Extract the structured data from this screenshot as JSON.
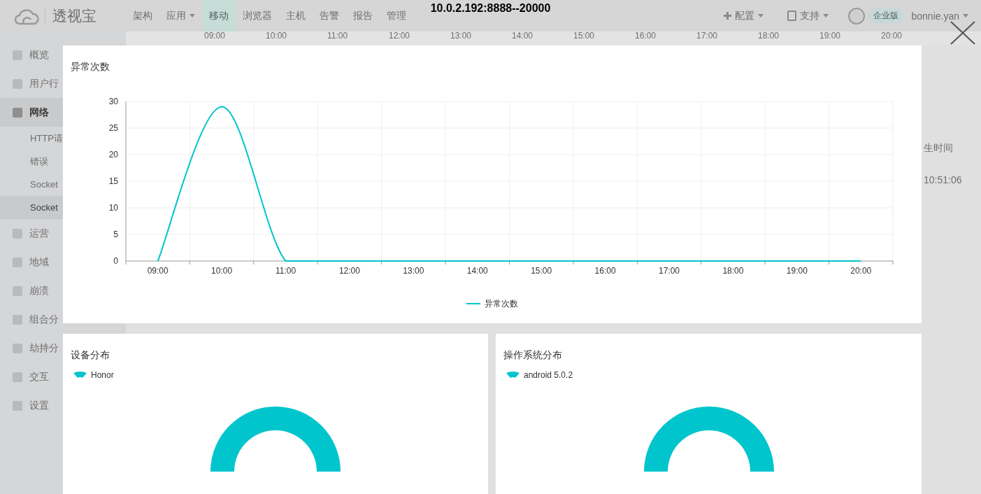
{
  "header": {
    "logo": "透视宝",
    "nav": [
      {
        "label": "架构",
        "selected": false,
        "has_menu": false
      },
      {
        "label": "应用",
        "selected": false,
        "has_menu": true
      },
      {
        "label": "移动",
        "selected": true,
        "has_menu": false
      },
      {
        "label": "浏览器",
        "selected": false,
        "has_menu": false
      },
      {
        "label": "主机",
        "selected": false,
        "has_menu": false
      },
      {
        "label": "告警",
        "selected": false,
        "has_menu": false
      },
      {
        "label": "报告",
        "selected": false,
        "has_menu": false
      },
      {
        "label": "管理",
        "selected": false,
        "has_menu": false
      }
    ],
    "config": "配置",
    "support": "支持",
    "edition_badge": "企业版",
    "user": "bonnie.yan"
  },
  "timeline": [
    "09:00",
    "10:00",
    "11:00",
    "12:00",
    "13:00",
    "14:00",
    "15:00",
    "16:00",
    "17:00",
    "18:00",
    "19:00",
    "20:00"
  ],
  "sidebar": {
    "items": [
      {
        "label": "概览",
        "selected": false
      },
      {
        "label": "用户行",
        "selected": false
      },
      {
        "label": "网络",
        "selected": true,
        "children": [
          {
            "label": "HTTP请",
            "selected": false
          },
          {
            "label": "错误",
            "selected": false
          },
          {
            "label": "Socket",
            "selected": false
          },
          {
            "label": "Socket",
            "selected": true
          }
        ]
      },
      {
        "label": "运营",
        "selected": false
      },
      {
        "label": "地域",
        "selected": false
      },
      {
        "label": "崩溃",
        "selected": false
      },
      {
        "label": "组合分",
        "selected": false
      },
      {
        "label": "劫持分",
        "selected": false
      },
      {
        "label": "交互",
        "selected": false
      },
      {
        "label": "设置",
        "selected": false
      }
    ]
  },
  "background_table": {
    "column_header": "生时间",
    "cell": "10:51:06"
  },
  "modal": {
    "title": "10.0.2.192:8888--20000",
    "cards": [
      {
        "kind": "line_chart",
        "chart_data": {
          "type": "line",
          "title": "异常次数",
          "categories": [
            "09:00",
            "10:00",
            "11:00",
            "12:00",
            "13:00",
            "14:00",
            "15:00",
            "16:00",
            "17:00",
            "18:00",
            "19:00",
            "20:00"
          ],
          "series": [
            {
              "name": "异常次数",
              "color": "#00c5cd",
              "values": [
                0,
                29,
                0,
                0,
                0,
                0,
                0,
                0,
                0,
                0,
                0,
                0
              ]
            }
          ],
          "grid": true,
          "ylim": [
            0,
            30
          ],
          "yticks": [
            0,
            5,
            10,
            15,
            20,
            25,
            30
          ]
        }
      },
      {
        "kind": "donut",
        "title": "设备分布",
        "legend": [
          "Honor"
        ]
      },
      {
        "kind": "donut",
        "title": "操作系统分布",
        "legend": [
          "android 5.0.2"
        ]
      }
    ]
  }
}
